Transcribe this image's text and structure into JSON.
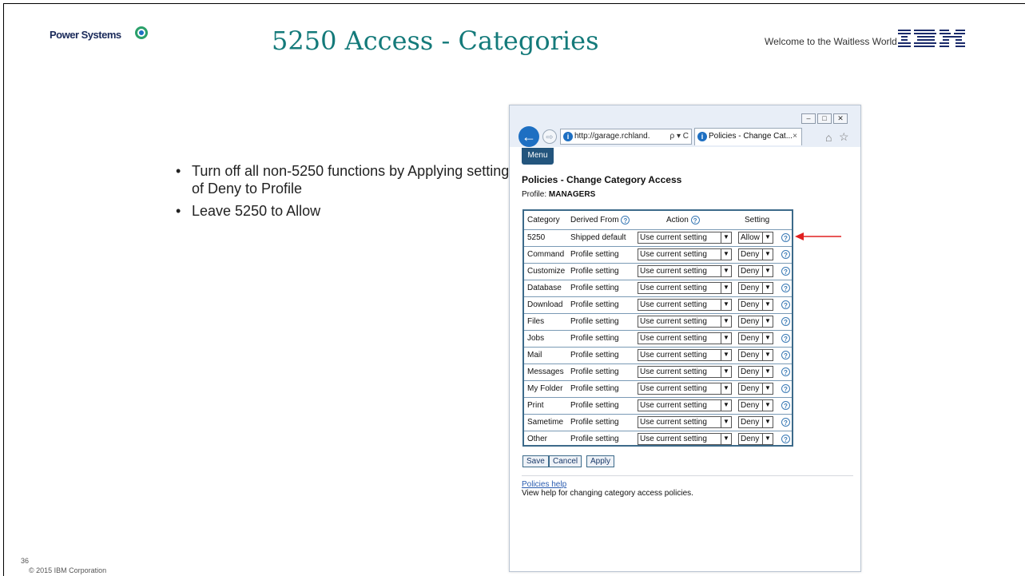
{
  "slide": {
    "brand": "Power Systems",
    "title": "5250 Access - Categories",
    "tagline": "Welcome to the Waitless World",
    "logo": "IBM",
    "bullets": [
      "Turn off all non-5250 functions by Applying setting of Deny to Profile",
      "Leave 5250 to Allow"
    ],
    "page_number": "36",
    "copyright": "© 2015 IBM Corporation"
  },
  "browser": {
    "address": "http://garage.rchland.",
    "address_tools": "ρ ▾ C",
    "tab_title": "Policies - Change Cat...",
    "tab_close": "×",
    "window_buttons": [
      "–",
      "□",
      "✕"
    ]
  },
  "page": {
    "menu_label": "Menu",
    "title": "Policies - Change Category Access",
    "profile_label": "Profile:",
    "profile_value": "MANAGERS",
    "table": {
      "headers": {
        "category": "Category",
        "derived": "Derived From",
        "action": "Action",
        "setting": "Setting"
      },
      "rows": [
        {
          "category": "5250",
          "derived": "Shipped default",
          "action": "Use current setting",
          "setting": "Allow"
        },
        {
          "category": "Command",
          "derived": "Profile setting",
          "action": "Use current setting",
          "setting": "Deny"
        },
        {
          "category": "Customize",
          "derived": "Profile setting",
          "action": "Use current setting",
          "setting": "Deny"
        },
        {
          "category": "Database",
          "derived": "Profile setting",
          "action": "Use current setting",
          "setting": "Deny"
        },
        {
          "category": "Download",
          "derived": "Profile setting",
          "action": "Use current setting",
          "setting": "Deny"
        },
        {
          "category": "Files",
          "derived": "Profile setting",
          "action": "Use current setting",
          "setting": "Deny"
        },
        {
          "category": "Jobs",
          "derived": "Profile setting",
          "action": "Use current setting",
          "setting": "Deny"
        },
        {
          "category": "Mail",
          "derived": "Profile setting",
          "action": "Use current setting",
          "setting": "Deny"
        },
        {
          "category": "Messages",
          "derived": "Profile setting",
          "action": "Use current setting",
          "setting": "Deny"
        },
        {
          "category": "My Folder",
          "derived": "Profile setting",
          "action": "Use current setting",
          "setting": "Deny"
        },
        {
          "category": "Print",
          "derived": "Profile setting",
          "action": "Use current setting",
          "setting": "Deny"
        },
        {
          "category": "Sametime",
          "derived": "Profile setting",
          "action": "Use current setting",
          "setting": "Deny"
        },
        {
          "category": "Other",
          "derived": "Profile setting",
          "action": "Use current setting",
          "setting": "Deny"
        }
      ]
    },
    "buttons": {
      "save": "Save",
      "cancel": "Cancel",
      "apply": "Apply"
    },
    "help_link": "Policies help",
    "help_desc": "View help for changing category access policies."
  },
  "colors": {
    "title_teal": "#147a7a",
    "table_border": "#3c6a8a",
    "menu_bg": "#23557d",
    "annotation_arrow": "#e02020"
  },
  "icons": [
    "power-systems-icon",
    "ibm-logo",
    "back-arrow-icon",
    "forward-arrow-icon",
    "site-info-icon",
    "help-icon",
    "home-icon",
    "favorites-star-icon",
    "red-annotation-arrow"
  ]
}
